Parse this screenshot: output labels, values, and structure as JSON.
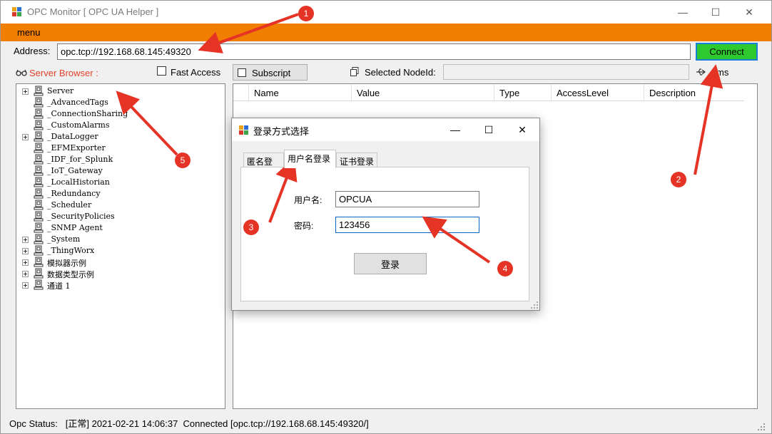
{
  "window": {
    "title": "OPC Monitor [ OPC UA Helper ]",
    "min_glyph": "—",
    "max_glyph": "☐",
    "close_glyph": "✕"
  },
  "menu": {
    "label": "menu"
  },
  "address": {
    "label": "Address:",
    "value": "opc.tcp://192.168.68.145:49320",
    "connect_label": "Connect"
  },
  "toolbar": {
    "server_browser_label": "Server Browser :",
    "fast_access_label": "Fast Access",
    "subscript_label": "Subscript",
    "selected_node_label": "Selected NodeId:",
    "ms_label": "ms"
  },
  "tree": [
    {
      "label": "Server",
      "expandable": true
    },
    {
      "label": "_AdvancedTags",
      "expandable": false
    },
    {
      "label": "_ConnectionSharing",
      "expandable": false
    },
    {
      "label": "_CustomAlarms",
      "expandable": false
    },
    {
      "label": "_DataLogger",
      "expandable": true
    },
    {
      "label": "_EFMExporter",
      "expandable": false
    },
    {
      "label": "_IDF_for_Splunk",
      "expandable": false
    },
    {
      "label": "_IoT_Gateway",
      "expandable": false
    },
    {
      "label": "_LocalHistorian",
      "expandable": false
    },
    {
      "label": "_Redundancy",
      "expandable": false
    },
    {
      "label": "_Scheduler",
      "expandable": false
    },
    {
      "label": "_SecurityPolicies",
      "expandable": false
    },
    {
      "label": "_SNMP Agent",
      "expandable": false
    },
    {
      "label": "_System",
      "expandable": true
    },
    {
      "label": "_ThingWorx",
      "expandable": true
    },
    {
      "label": "模拟器示例",
      "expandable": true
    },
    {
      "label": "数据类型示例",
      "expandable": true
    },
    {
      "label": "通道 1",
      "expandable": true
    }
  ],
  "grid": {
    "columns": [
      "Name",
      "Value",
      "Type",
      "AccessLevel",
      "Description"
    ]
  },
  "status": {
    "text": "Opc Status:   [正常] 2021-02-21 14:06:37  Connected [opc.tcp://192.168.68.145:49320/]"
  },
  "dialog": {
    "title": "登录方式选择",
    "tabs": [
      "匿名登录",
      "用户名登录",
      "证书登录"
    ],
    "active_tab": "用户名登录",
    "username_label": "用户名:",
    "username_value": "OPCUA",
    "password_label": "密码:",
    "password_value": "123456",
    "login_label": "登录"
  },
  "annotations": [
    "1",
    "2",
    "3",
    "4",
    "5"
  ],
  "colors": {
    "menu_bar": "#f07e00",
    "connect_button": "#2ec92e",
    "server_browser_label": "#e2432b",
    "annotation": "#e53326"
  }
}
